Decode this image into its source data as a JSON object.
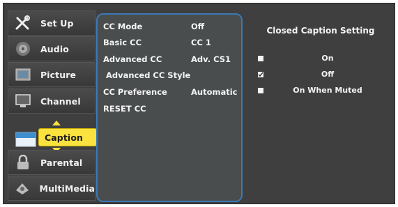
{
  "sidebar": {
    "items": [
      {
        "label": "Set Up",
        "icon": "tools-icon"
      },
      {
        "label": "Audio",
        "icon": "speaker-icon"
      },
      {
        "label": "Picture",
        "icon": "picture-icon"
      },
      {
        "label": "Channel",
        "icon": "tv-icon"
      },
      {
        "label": "Caption",
        "icon": "caption-icon",
        "active": true
      },
      {
        "label": "Parental",
        "icon": "lock-icon"
      },
      {
        "label": "MultiMedia",
        "icon": "multimedia-icon"
      }
    ]
  },
  "menu": {
    "rows": [
      {
        "label": "CC Mode",
        "value": "Off"
      },
      {
        "label": "Basic CC",
        "value": "CC 1"
      },
      {
        "label": "Advanced CC",
        "value": "Adv. CS1"
      },
      {
        "label": "Advanced CC Style",
        "value": ""
      },
      {
        "label": "CC Preference",
        "value": "Automatic"
      },
      {
        "label": "RESET CC",
        "value": ""
      }
    ]
  },
  "panel": {
    "title": "Closed Caption Setting",
    "options": [
      {
        "label": "On",
        "checked": false
      },
      {
        "label": "Off",
        "checked": true
      },
      {
        "label": "On When Muted",
        "checked": false
      }
    ]
  },
  "colors": {
    "highlight": "#fbe23f",
    "menu_border": "#3b79b6",
    "background": "#3f3f3f"
  }
}
